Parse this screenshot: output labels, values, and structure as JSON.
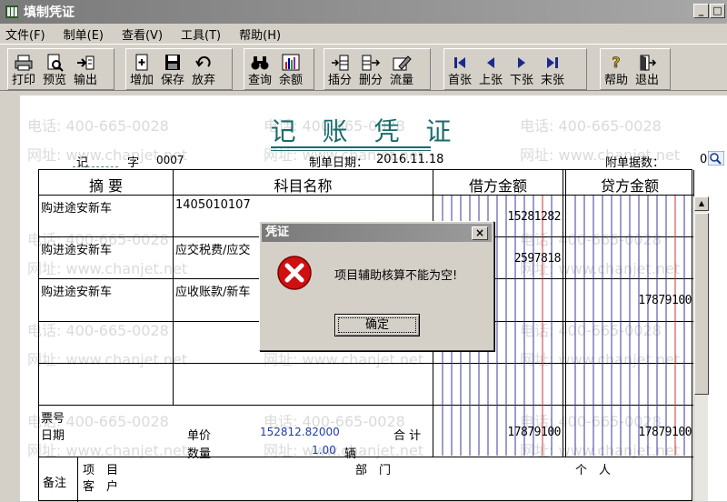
{
  "window": {
    "title": "填制凭证",
    "btn_min": "_",
    "btn_max": "□"
  },
  "menu": [
    "文件(F)",
    "制单(E)",
    "查看(V)",
    "工具(T)",
    "帮助(H)"
  ],
  "toolbar": {
    "print": "打印",
    "preview": "预览",
    "export": "输出",
    "add": "增加",
    "save": "保存",
    "abandon": "放弃",
    "query": "查询",
    "balance": "余额",
    "insert_entry": "插分",
    "delete_entry": "删分",
    "flow": "流量",
    "first": "首张",
    "prev": "上张",
    "next": "下张",
    "last": "末张",
    "help": "帮助",
    "exit": "退出"
  },
  "voucher": {
    "title": "记 账 凭 证",
    "type": "记",
    "zi": "字",
    "number": "0007",
    "date_label": "制单日期：",
    "date": "2016.11.18",
    "attach_label": "附单据数：",
    "attach_count": "0",
    "headers": {
      "summary": "摘 要",
      "account": "科目名称",
      "debit": "借方金额",
      "credit": "贷方金额"
    },
    "rows": [
      {
        "summary": "购进途安新车",
        "account": "1405010107",
        "debit": "15281282",
        "credit": ""
      },
      {
        "summary": "购进途安新车",
        "account": "应交税费/应交",
        "debit": "2597818",
        "credit": ""
      },
      {
        "summary": "购进途安新车",
        "account": "应收账款/新车",
        "debit": "",
        "credit": "17879100"
      }
    ],
    "footer": {
      "ticket_label": "票号",
      "date_label": "日期",
      "price_label": "单价",
      "price": "152812.82000",
      "qty_label": "数量",
      "qty": "1.00",
      "unit": "辆",
      "total_label": "合 计",
      "total_debit": "17879100",
      "total_credit": "17879100"
    },
    "remarks": {
      "label": "备注",
      "project_label": "项　目",
      "customer_label": "客　户",
      "department_label": "部　门",
      "person_label": "个　人"
    }
  },
  "watermark": {
    "phone": "电话: 400-665-0028",
    "site": "网址: www.chanjet.net"
  },
  "dialog": {
    "title": "凭证",
    "close": "×",
    "message": "项目辅助核算不能为空!",
    "ok": "确定"
  },
  "colors": {
    "title_teal": "#1a6b6b",
    "amount_blue": "#1e3ea8",
    "error_red": "#d01010",
    "debit_red_line": "#cc3333"
  }
}
